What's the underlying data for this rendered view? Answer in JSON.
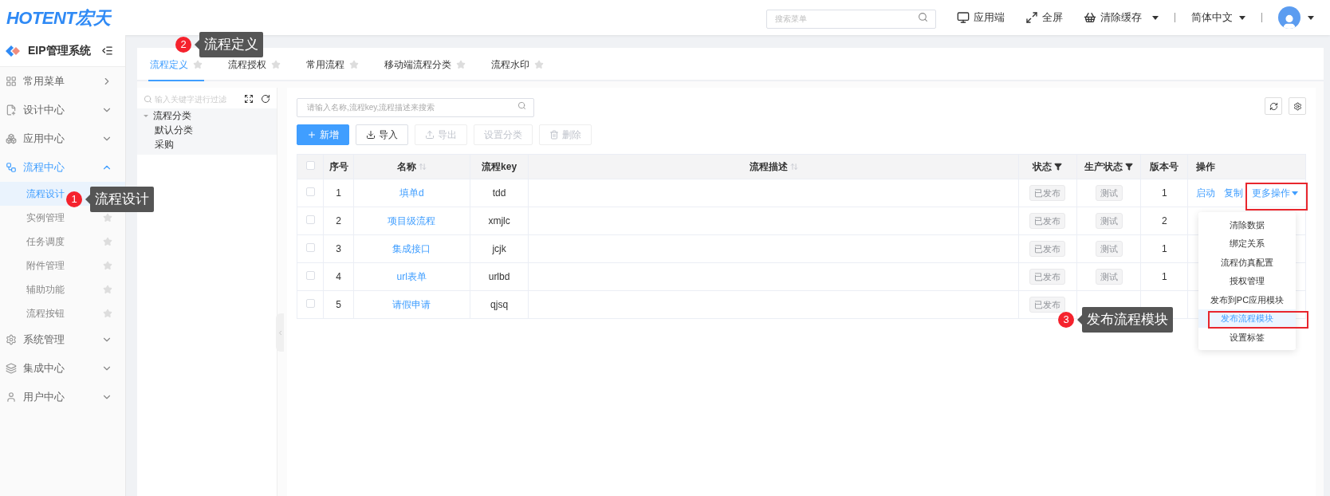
{
  "header": {
    "logo": "HOTENT宏天",
    "search": {
      "placeholder": "搜索菜单"
    },
    "actions": [
      {
        "label": "应用端",
        "kind": "monitor"
      },
      {
        "label": "全屏",
        "kind": "fullscreen"
      },
      {
        "label": "清除缓存",
        "kind": "cache"
      }
    ],
    "language": "简体中文"
  },
  "sidebar": {
    "title": "EIP管理系统",
    "items": [
      {
        "label": "常用菜单",
        "kind": "flyout"
      },
      {
        "label": "设计中心",
        "kind": "group",
        "expanded": false
      },
      {
        "label": "应用中心",
        "kind": "group",
        "expanded": false
      },
      {
        "label": "流程中心",
        "kind": "group",
        "expanded": true,
        "children": [
          {
            "label": "流程设计",
            "selected": true
          },
          {
            "label": "实例管理",
            "selected": false
          },
          {
            "label": "任务调度",
            "selected": false
          },
          {
            "label": "附件管理",
            "selected": false
          },
          {
            "label": "辅助功能",
            "selected": false
          },
          {
            "label": "流程按钮",
            "selected": false
          }
        ]
      },
      {
        "label": "系统管理",
        "kind": "group",
        "expanded": false
      },
      {
        "label": "集成中心",
        "kind": "group",
        "expanded": false
      },
      {
        "label": "用户中心",
        "kind": "group",
        "expanded": false
      }
    ]
  },
  "tabs": [
    {
      "label": "流程定义",
      "selected": true
    },
    {
      "label": "流程授权",
      "selected": false
    },
    {
      "label": "常用流程",
      "selected": false
    },
    {
      "label": "移动端流程分类",
      "selected": false
    },
    {
      "label": "流程水印",
      "selected": false
    }
  ],
  "tree": {
    "filter_placeholder": "输入关键字进行过滤",
    "nodes": [
      {
        "label": "流程分类",
        "expanded": true,
        "children": [
          {
            "label": "默认分类"
          },
          {
            "label": "采购"
          }
        ]
      }
    ]
  },
  "toolbar": {
    "search_placeholder": "请输入名称,流程key,流程描述来搜索",
    "buttons": [
      {
        "label": "新增",
        "kind": "add",
        "disabled": false
      },
      {
        "label": "导入",
        "kind": "import",
        "disabled": false
      },
      {
        "label": "导出",
        "kind": "export",
        "disabled": true
      },
      {
        "label": "设置分类",
        "kind": "plain",
        "disabled": true
      },
      {
        "label": "删除",
        "kind": "delete",
        "disabled": true
      }
    ]
  },
  "table": {
    "select_all_checked": false,
    "columns": [
      {
        "label": "序号",
        "kind": "plain"
      },
      {
        "label": "名称",
        "kind": "sort"
      },
      {
        "label": "流程key",
        "kind": "plain"
      },
      {
        "label": "流程描述",
        "kind": "sort"
      },
      {
        "label": "状态",
        "kind": "filter"
      },
      {
        "label": "生产状态",
        "kind": "filter"
      },
      {
        "label": "版本号",
        "kind": "plain"
      },
      {
        "label": "操作",
        "kind": "plain"
      }
    ],
    "rows": [
      {
        "checked": false,
        "index": "1",
        "name": "填单d",
        "key": "tdd",
        "status": "已发布",
        "production_state": "测试",
        "version": "1",
        "actions": [
          "启动",
          "复制",
          "更多操作"
        ]
      },
      {
        "checked": false,
        "index": "2",
        "name": "项目级流程",
        "key": "xmjlc",
        "status": "已发布",
        "production_state": "测试",
        "version": "2"
      },
      {
        "checked": false,
        "index": "3",
        "name": "集成接口",
        "key": "jcjk",
        "status": "已发布",
        "production_state": "测试",
        "version": "1"
      },
      {
        "checked": false,
        "index": "4",
        "name": "url表单",
        "key": "urlbd",
        "status": "已发布",
        "production_state": "测试",
        "version": "1"
      },
      {
        "checked": false,
        "index": "5",
        "name": "请假申请",
        "key": "qjsq",
        "status": "已发布"
      }
    ]
  },
  "dropdown_menu": [
    {
      "label": "清除数据",
      "selected": false
    },
    {
      "label": "绑定关系",
      "selected": false
    },
    {
      "label": "流程仿真配置",
      "selected": false
    },
    {
      "label": "授权管理",
      "selected": false
    },
    {
      "label": "发布到PC应用模块",
      "selected": false
    },
    {
      "label": "发布流程模块",
      "selected": true
    },
    {
      "label": "设置标签",
      "selected": false
    }
  ],
  "callouts": [
    {
      "number": "1",
      "text": "流程设计"
    },
    {
      "number": "2",
      "text": "流程定义"
    },
    {
      "number": "3",
      "text": "发布流程模块"
    }
  ]
}
